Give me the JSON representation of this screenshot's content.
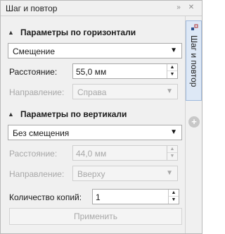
{
  "window": {
    "title": "Шаг и повтор"
  },
  "titlebar": {
    "collapse_icon": "»",
    "close_icon": "✕"
  },
  "horizontal": {
    "section_title": "Параметры по горизонтали",
    "mode": "Смещение",
    "distance_label": "Расстояние:",
    "distance_value": "55,0 мм",
    "direction_label": "Направление:",
    "direction_value": "Справа"
  },
  "vertical": {
    "section_title": "Параметры по вертикали",
    "mode": "Без смещения",
    "distance_label": "Расстояние:",
    "distance_value": "44,0 мм",
    "direction_label": "Направление:",
    "direction_value": "Вверху"
  },
  "copies": {
    "label": "Количество копий:",
    "value": "1"
  },
  "apply_label": "Применить",
  "rail": {
    "tab_label": "Шаг и повтор",
    "add_icon": "+"
  },
  "glyphs": {
    "collapse_triangle": "▲",
    "dropdown_arrow": "▼",
    "spin_up": "▲",
    "spin_down": "▼"
  }
}
